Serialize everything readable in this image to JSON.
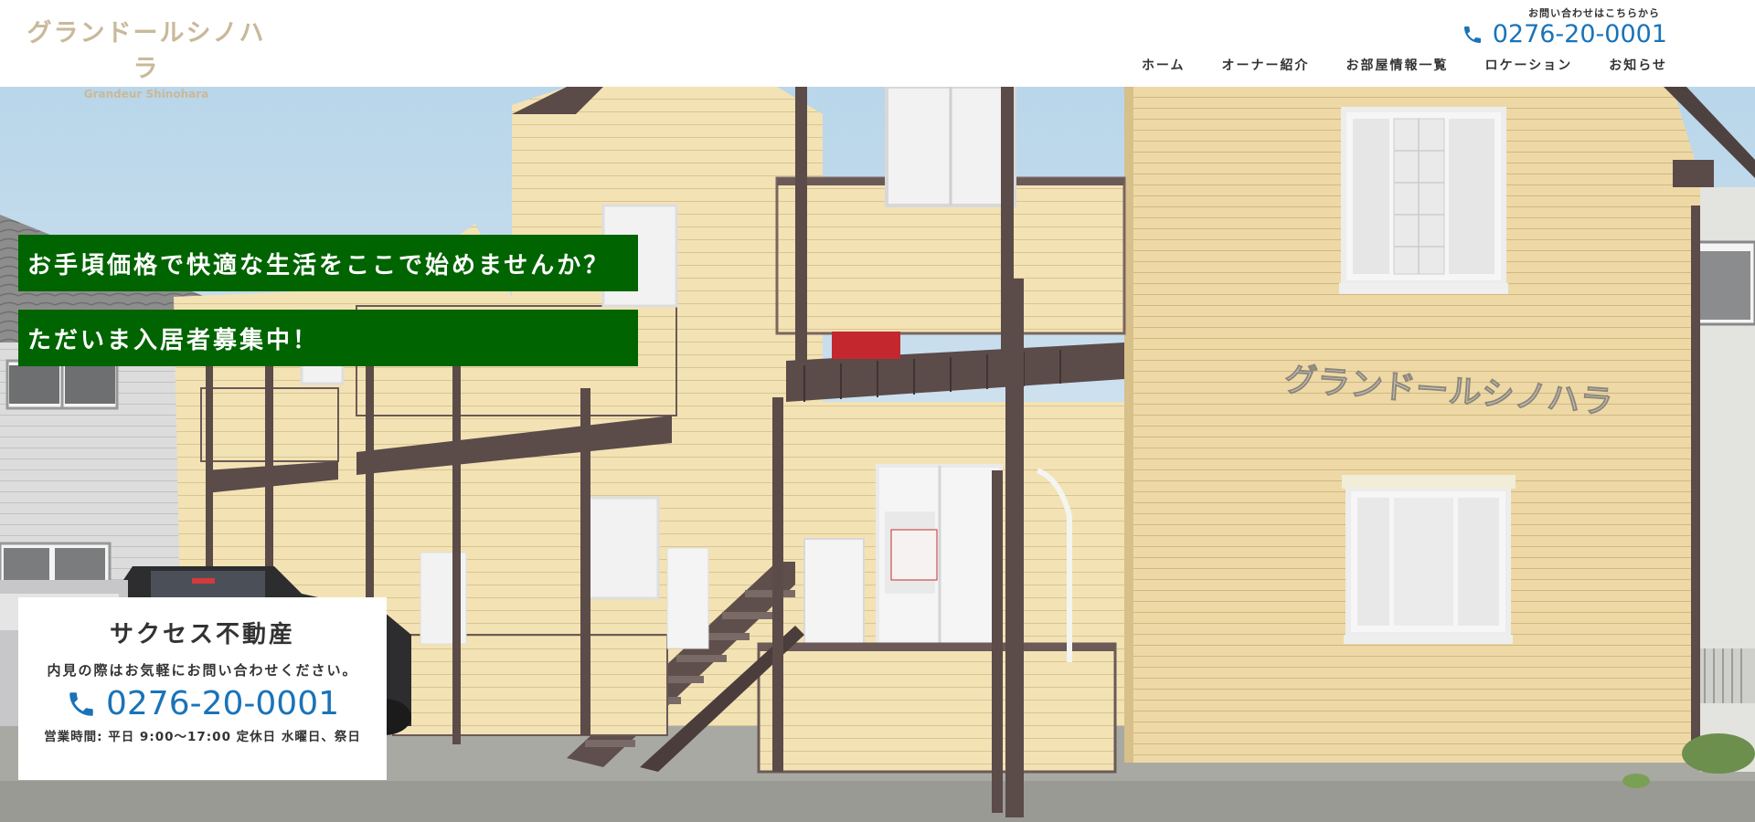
{
  "site": {
    "logo_main": "グランドールシノハラ",
    "logo_sub": "Grandeur Shinohara"
  },
  "header": {
    "contact_note": "お問い合わせはこちらから",
    "phone": "0276-20-0001",
    "phone_icon": "phone-icon"
  },
  "nav": {
    "items": [
      {
        "label": "ホーム"
      },
      {
        "label": "オーナー紹介"
      },
      {
        "label": "お部屋情報一覧"
      },
      {
        "label": "ロケーション"
      },
      {
        "label": "お知らせ"
      }
    ]
  },
  "hero": {
    "banner_1": "お手頃価格で快適な生活をここで始めませんか？",
    "banner_2": "ただいま入居者募集中！",
    "building_sign": "グランドールシノハラ"
  },
  "info_box": {
    "title": "サクセス不動産",
    "text": "内見の際はお気軽にお問い合わせください。",
    "phone": "0276-20-0001",
    "hours": "営業時間: 平日 9:00〜17:00 定休日 水曜日、祭日"
  },
  "colors": {
    "accent_phone": "#1a73b8",
    "banner_green": "#006400",
    "logo_beige": "#c9b99a"
  }
}
